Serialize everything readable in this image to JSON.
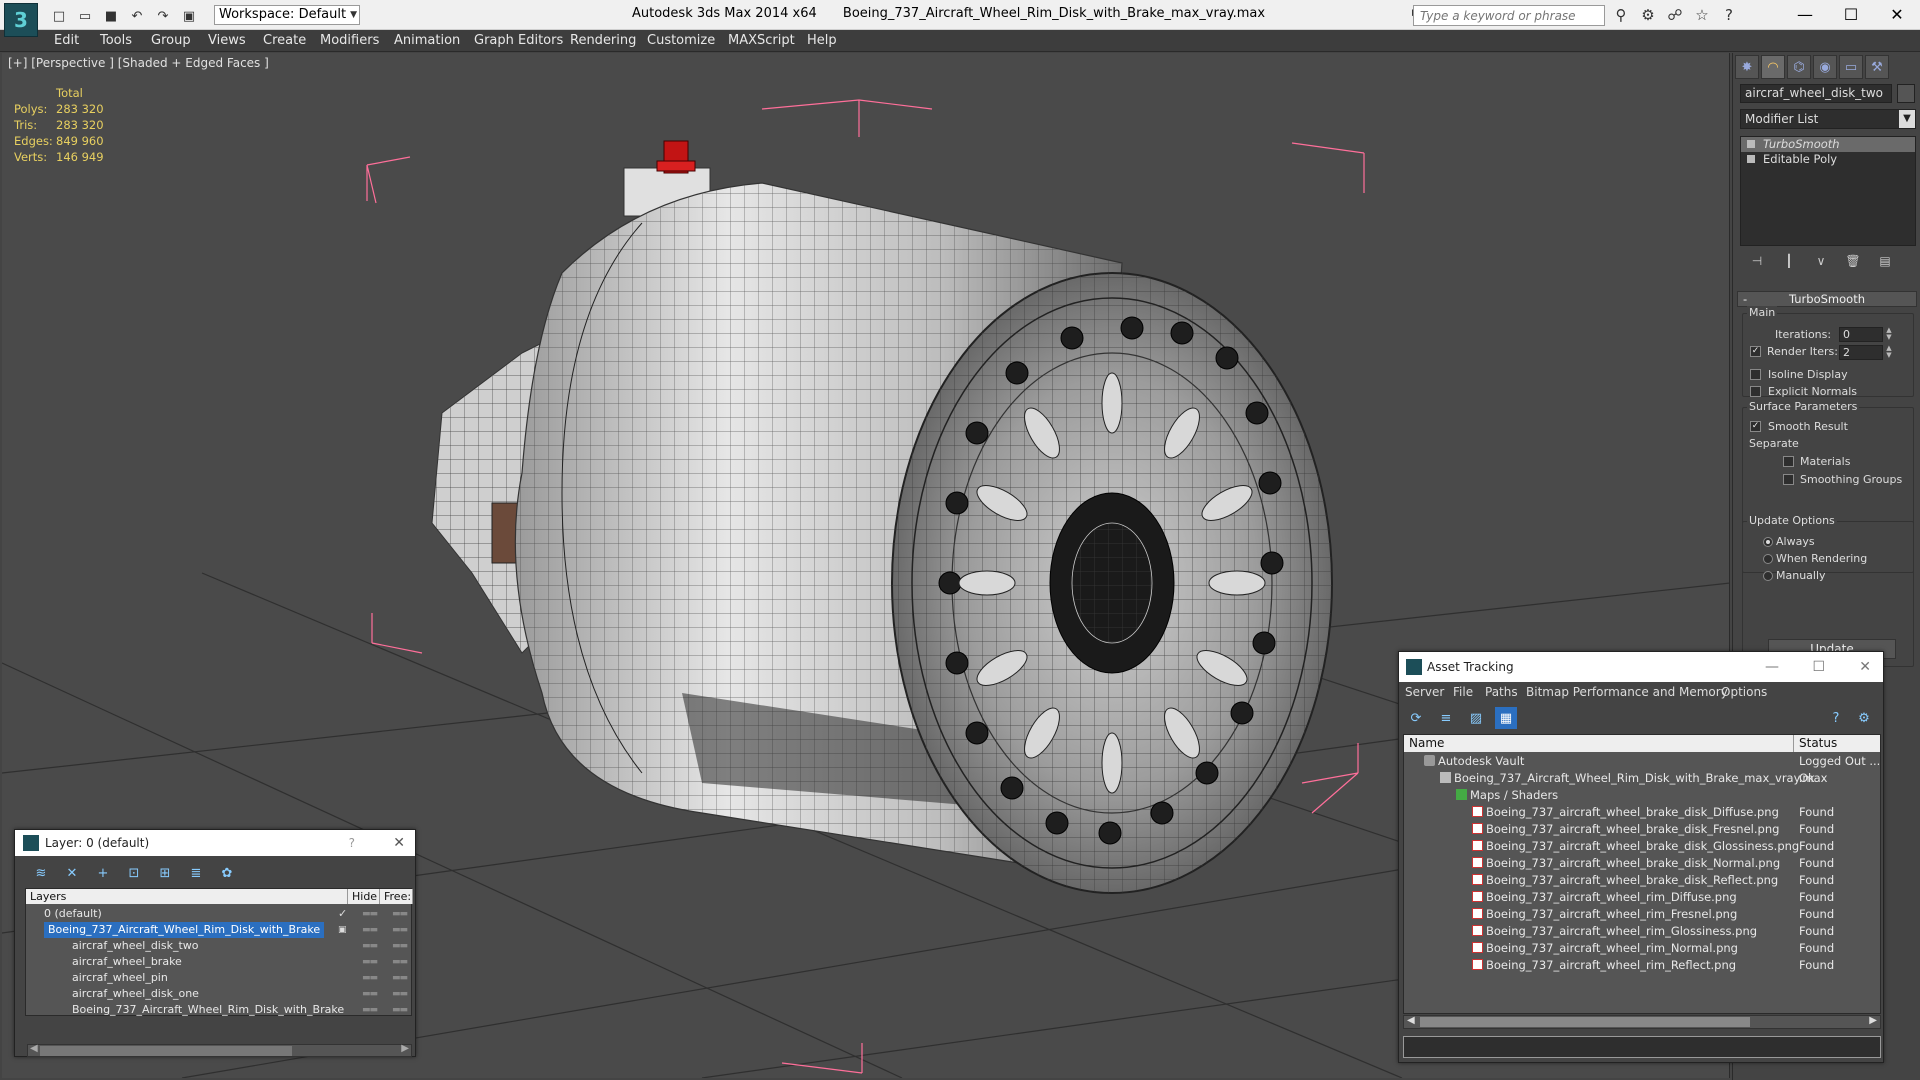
{
  "window": {
    "app_name": "Autodesk 3ds Max  2014 x64",
    "file_name": "Boeing_737_Aircraft_Wheel_Rim_Disk_with_Brake_max_vray.max",
    "workspace": "Workspace: Default",
    "search_placeholder": "Type a keyword or phrase"
  },
  "menu": [
    "Edit",
    "Tools",
    "Group",
    "Views",
    "Create",
    "Modifiers",
    "Animation",
    "Graph Editors",
    "Rendering",
    "Customize",
    "MAXScript",
    "Help"
  ],
  "viewport": {
    "label": "[+] [Perspective ] [Shaded + Edged Faces ]",
    "stats": {
      "header": "Total",
      "rows": [
        {
          "k": "Polys:",
          "v": "283 320"
        },
        {
          "k": "Tris:",
          "v": "283 320"
        },
        {
          "k": "Edges:",
          "v": "849 960"
        },
        {
          "k": "Verts:",
          "v": "146 949"
        }
      ]
    }
  },
  "command_panel": {
    "object_name": "aircraf_wheel_disk_two",
    "modifier_list": "Modifier List",
    "stack": [
      "TurboSmooth",
      "Editable Poly"
    ],
    "rollout": "TurboSmooth",
    "main_group": "Main",
    "iterations_label": "Iterations:",
    "iterations_value": "0",
    "render_iters_label": "Render Iters:",
    "render_iters_value": "2",
    "isoline_display": "Isoline Display",
    "explicit_normals": "Explicit Normals",
    "surface_params": "Surface Parameters",
    "smooth_result": "Smooth Result",
    "separate": "Separate",
    "materials": "Materials",
    "smoothing_groups": "Smoothing Groups",
    "update_options": "Update Options",
    "always": "Always",
    "when_rendering": "When Rendering",
    "manually": "Manually",
    "update_button": "Update"
  },
  "layer_dialog": {
    "title": "Layer: 0 (default)",
    "help": "?",
    "col_layers": "Layers",
    "col_hide": "Hide",
    "col_freeze": "Free:",
    "rows": [
      {
        "name": "0 (default)",
        "indent": 1
      },
      {
        "name": "Boeing_737_Aircraft_Wheel_Rim_Disk_with_Brake",
        "indent": 1
      },
      {
        "name": "aircraf_wheel_disk_two",
        "indent": 2
      },
      {
        "name": "aircraf_wheel_brake",
        "indent": 2
      },
      {
        "name": "aircraf_wheel_pin",
        "indent": 2
      },
      {
        "name": "aircraf_wheel_disk_one",
        "indent": 2
      },
      {
        "name": "Boeing_737_Aircraft_Wheel_Rim_Disk_with_Brake",
        "indent": 2
      }
    ]
  },
  "asset_dialog": {
    "title": "Asset Tracking",
    "menu": [
      "Server",
      "File",
      "Paths",
      "Bitmap Performance and Memory",
      "Options"
    ],
    "col_name": "Name",
    "col_status": "Status",
    "rows": [
      {
        "name": "Autodesk Vault",
        "status": "Logged Out ...",
        "indent": 1,
        "icon": "vault"
      },
      {
        "name": "Boeing_737_Aircraft_Wheel_Rim_Disk_with_Brake_max_vray.max",
        "status": "Ok",
        "indent": 2,
        "icon": "max"
      },
      {
        "name": "Maps / Shaders",
        "status": "",
        "indent": 3,
        "icon": "maps"
      },
      {
        "name": "Boeing_737_aircraft_wheel_brake_disk_Diffuse.png",
        "status": "Found",
        "indent": 4,
        "icon": "png"
      },
      {
        "name": "Boeing_737_aircraft_wheel_brake_disk_Fresnel.png",
        "status": "Found",
        "indent": 4,
        "icon": "png"
      },
      {
        "name": "Boeing_737_aircraft_wheel_brake_disk_Glossiness.png",
        "status": "Found",
        "indent": 4,
        "icon": "png"
      },
      {
        "name": "Boeing_737_aircraft_wheel_brake_disk_Normal.png",
        "status": "Found",
        "indent": 4,
        "icon": "png"
      },
      {
        "name": "Boeing_737_aircraft_wheel_brake_disk_Reflect.png",
        "status": "Found",
        "indent": 4,
        "icon": "png"
      },
      {
        "name": "Boeing_737_aircraft_wheel_rim_Diffuse.png",
        "status": "Found",
        "indent": 4,
        "icon": "png"
      },
      {
        "name": "Boeing_737_aircraft_wheel_rim_Fresnel.png",
        "status": "Found",
        "indent": 4,
        "icon": "png"
      },
      {
        "name": "Boeing_737_aircraft_wheel_rim_Glossiness.png",
        "status": "Found",
        "indent": 4,
        "icon": "png"
      },
      {
        "name": "Boeing_737_aircraft_wheel_rim_Normal.png",
        "status": "Found",
        "indent": 4,
        "icon": "png"
      },
      {
        "name": "Boeing_737_aircraft_wheel_rim_Reflect.png",
        "status": "Found",
        "indent": 4,
        "icon": "png"
      }
    ]
  },
  "colors": {
    "stats": "#e8d060",
    "selection": "#2b6fc0",
    "bbox": "#ff6f9a"
  }
}
